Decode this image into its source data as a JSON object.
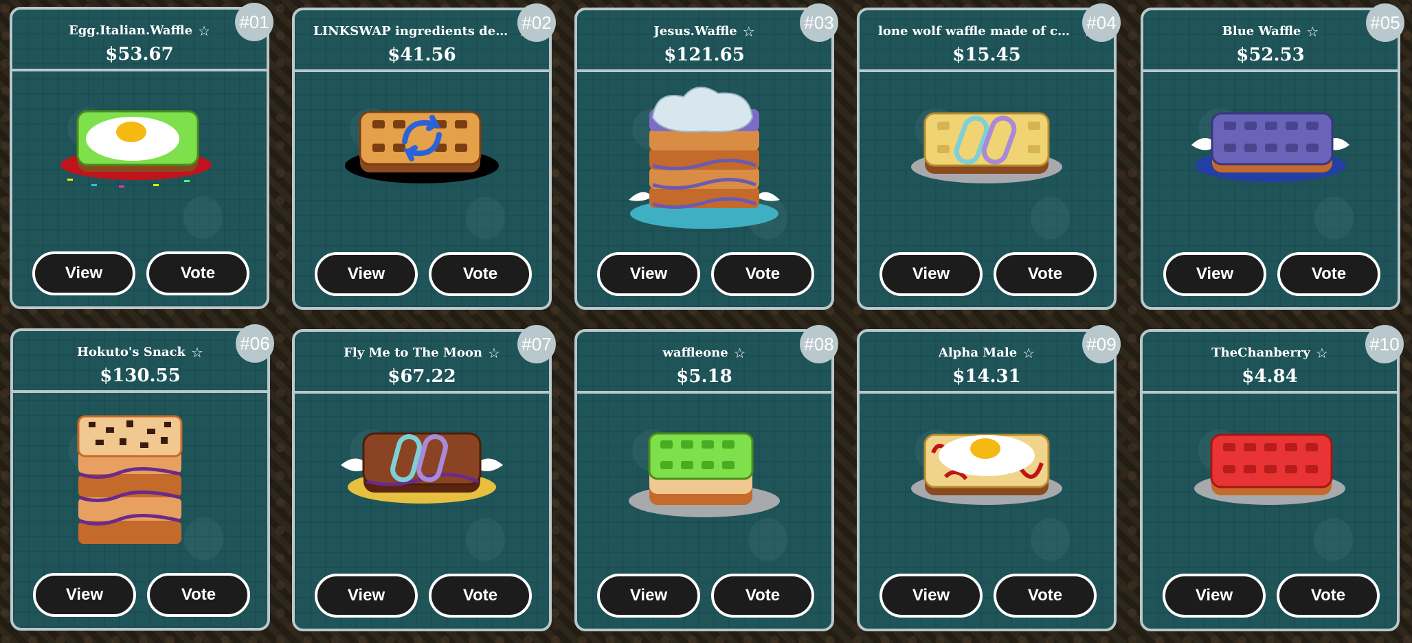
{
  "view_label": "View",
  "vote_label": "Vote",
  "favorite_icon": "☆",
  "cards": [
    {
      "number": "#01",
      "name": "Egg.Italian.Waffle",
      "price": "$53.67",
      "art": "egg-green"
    },
    {
      "number": "#02",
      "name": "LINKSWAP ingredients delayed...",
      "price": "$41.56",
      "art": "swap"
    },
    {
      "number": "#03",
      "name": "Jesus.Waffle",
      "price": "$121.65",
      "art": "stack-cream"
    },
    {
      "number": "#04",
      "name": "lone wolf waffle made of choco",
      "price": "$15.45",
      "art": "yellow-logo"
    },
    {
      "number": "#05",
      "name": "Blue Waffle",
      "price": "$52.53",
      "art": "blue-wings"
    },
    {
      "number": "#06",
      "name": "Hokuto's Snack",
      "price": "$130.55",
      "art": "stack-choco"
    },
    {
      "number": "#07",
      "name": "Fly Me to The Moon",
      "price": "$67.22",
      "art": "choco-logo-wings"
    },
    {
      "number": "#08",
      "name": "waffleone",
      "price": "$5.18",
      "art": "green-double"
    },
    {
      "number": "#09",
      "name": "Alpha Male",
      "price": "$14.31",
      "art": "egg-sauce"
    },
    {
      "number": "#10",
      "name": "TheChanberry",
      "price": "$4.84",
      "art": "red"
    }
  ]
}
